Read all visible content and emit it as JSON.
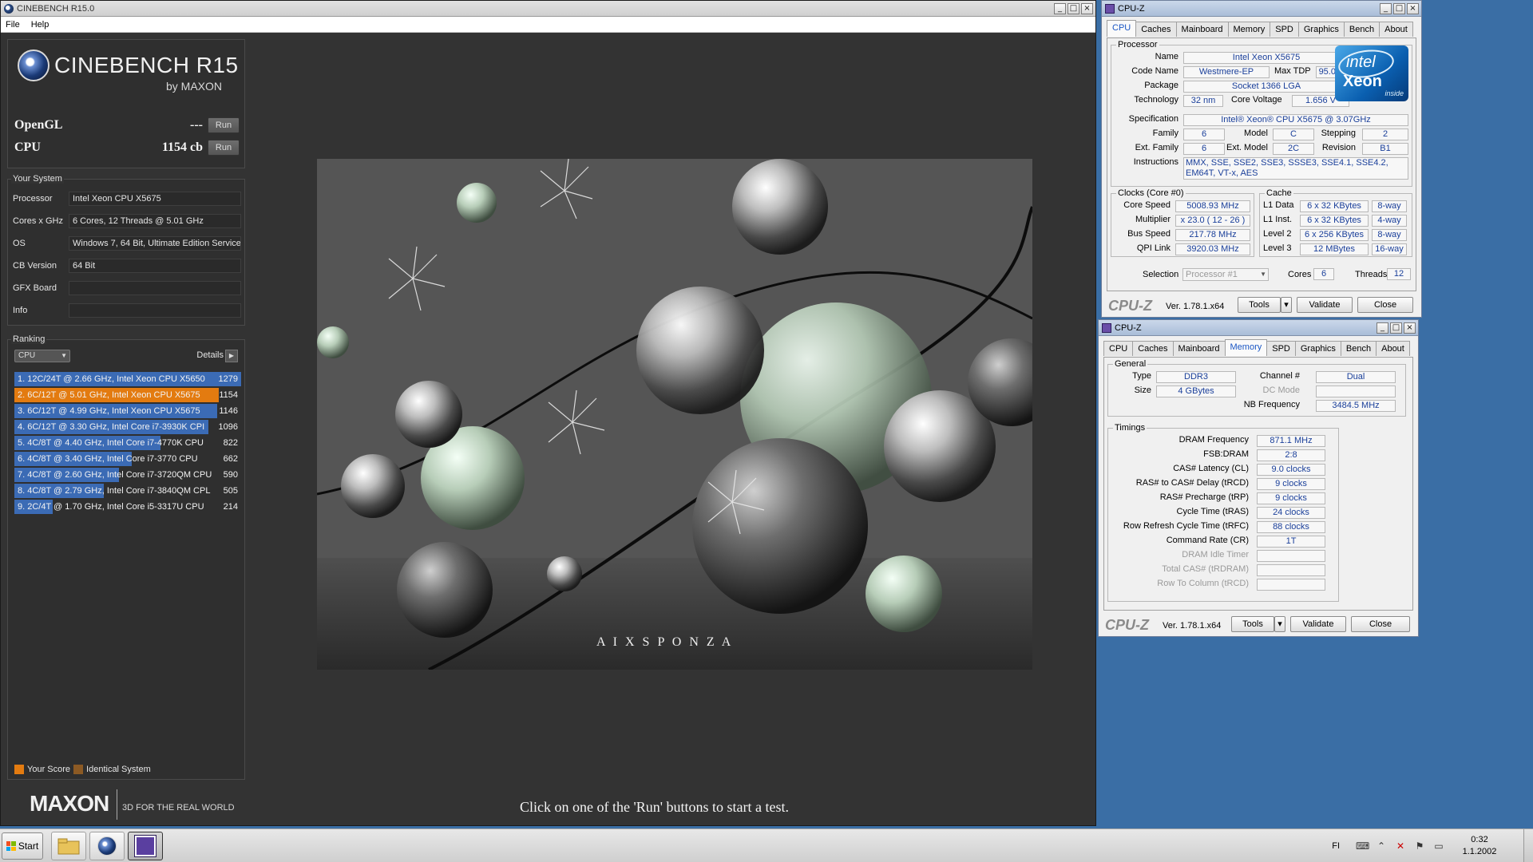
{
  "cinebench": {
    "window_title": "CINEBENCH R15.0",
    "menu": [
      "File",
      "Help"
    ],
    "logo_text": "CINEBENCH R15",
    "logo_by": "by MAXON",
    "tests": [
      {
        "name": "OpenGL",
        "score": "---",
        "run": "Run"
      },
      {
        "name": "CPU",
        "score": "1154 cb",
        "run": "Run"
      }
    ],
    "your_system": {
      "title": "Your System",
      "rows": [
        {
          "label": "Processor",
          "value": "Intel Xeon CPU X5675"
        },
        {
          "label": "Cores x GHz",
          "value": "6 Cores, 12 Threads @ 5.01 GHz"
        },
        {
          "label": "OS",
          "value": "Windows 7, 64 Bit, Ultimate Edition Service"
        },
        {
          "label": "CB Version",
          "value": "64 Bit"
        },
        {
          "label": "GFX Board",
          "value": ""
        },
        {
          "label": "Info",
          "value": ""
        }
      ]
    },
    "ranking": {
      "title": "Ranking",
      "select": "CPU",
      "details": "Details",
      "max_score": 1279,
      "items": [
        {
          "label": "1. 12C/24T @ 2.66 GHz, Intel Xeon CPU X5650",
          "score": 1279,
          "kind": "other"
        },
        {
          "label": "2. 6C/12T @ 5.01 GHz, Intel Xeon CPU X5675",
          "score": 1154,
          "kind": "yours"
        },
        {
          "label": "3. 6C/12T @ 4.99 GHz, Intel Xeon CPU X5675",
          "score": 1146,
          "kind": "other"
        },
        {
          "label": "4. 6C/12T @ 3.30 GHz,  Intel Core i7-3930K CPI",
          "score": 1096,
          "kind": "other"
        },
        {
          "label": "5. 4C/8T @ 4.40 GHz, Intel Core i7-4770K CPU",
          "score": 822,
          "kind": "other"
        },
        {
          "label": "6. 4C/8T @ 3.40 GHz,  Intel Core i7-3770 CPU",
          "score": 662,
          "kind": "other"
        },
        {
          "label": "7. 4C/8T @ 2.60 GHz, Intel Core i7-3720QM CPU",
          "score": 590,
          "kind": "other"
        },
        {
          "label": "8. 4C/8T @ 2.79 GHz, Intel Core i7-3840QM CPL",
          "score": 505,
          "kind": "other"
        },
        {
          "label": "9. 2C/4T @ 1.70 GHz,  Intel Core i5-3317U CPU",
          "score": 214,
          "kind": "other"
        }
      ],
      "legend_yours": "Your Score",
      "legend_identical": "Identical System"
    },
    "maxon_logo": "MAXON",
    "maxon_tagline": "3D FOR THE REAL WORLD",
    "render_watermark": "A I X S P O N Z A",
    "status": "Click on one of the 'Run' buttons to start a test.",
    "colors": {
      "yours": "#e37b10",
      "identical": "#8c5a24",
      "other": "#3b6bb5"
    }
  },
  "cpuz_cpu": {
    "title": "CPU-Z",
    "tabs": [
      "CPU",
      "Caches",
      "Mainboard",
      "Memory",
      "SPD",
      "Graphics",
      "Bench",
      "About"
    ],
    "active_tab": "CPU",
    "processor": {
      "title": "Processor",
      "name_label": "Name",
      "name": "Intel Xeon X5675",
      "code_name_label": "Code Name",
      "code_name": "Westmere-EP",
      "max_tdp_label": "Max TDP",
      "max_tdp": "95.0 W",
      "package_label": "Package",
      "package": "Socket 1366 LGA",
      "technology_label": "Technology",
      "technology": "32 nm",
      "core_voltage_label": "Core Voltage",
      "core_voltage": "1.656 V",
      "specification_label": "Specification",
      "specification": "Intel® Xeon® CPU           X5675  @ 3.07GHz",
      "family_label": "Family",
      "family": "6",
      "model_label": "Model",
      "model": "C",
      "stepping_label": "Stepping",
      "stepping": "2",
      "ext_family_label": "Ext. Family",
      "ext_family": "6",
      "ext_model_label": "Ext. Model",
      "ext_model": "2C",
      "revision_label": "Revision",
      "revision": "B1",
      "instructions_label": "Instructions",
      "instructions": "MMX, SSE, SSE2, SSE3, SSSE3, SSE4.1, SSE4.2, EM64T, VT-x, AES"
    },
    "intel_logo": {
      "brand": "intel",
      "product": "Xeon",
      "inside": "inside"
    },
    "clocks": {
      "title": "Clocks (Core #0)",
      "core_speed_label": "Core Speed",
      "core_speed": "5008.93 MHz",
      "multiplier_label": "Multiplier",
      "multiplier": "x 23.0 ( 12 - 26 )",
      "bus_speed_label": "Bus Speed",
      "bus_speed": "217.78 MHz",
      "qpi_label": "QPI Link",
      "qpi": "3920.03 MHz"
    },
    "cache": {
      "title": "Cache",
      "rows": [
        {
          "label": "L1 Data",
          "size": "6 x 32 KBytes",
          "way": "8-way"
        },
        {
          "label": "L1 Inst.",
          "size": "6 x 32 KBytes",
          "way": "4-way"
        },
        {
          "label": "Level 2",
          "size": "6 x 256 KBytes",
          "way": "8-way"
        },
        {
          "label": "Level 3",
          "size": "12 MBytes",
          "way": "16-way"
        }
      ]
    },
    "selection_label": "Selection",
    "selection": "Processor #1",
    "cores_label": "Cores",
    "cores": "6",
    "threads_label": "Threads",
    "threads": "12",
    "brand": "CPU-Z",
    "version": "Ver. 1.78.1.x64",
    "tools": "Tools",
    "validate": "Validate",
    "close": "Close"
  },
  "cpuz_mem": {
    "title": "CPU-Z",
    "tabs": [
      "CPU",
      "Caches",
      "Mainboard",
      "Memory",
      "SPD",
      "Graphics",
      "Bench",
      "About"
    ],
    "active_tab": "Memory",
    "general": {
      "title": "General",
      "type_label": "Type",
      "type": "DDR3",
      "size_label": "Size",
      "size": "4 GBytes",
      "channel_label": "Channel #",
      "channel": "Dual",
      "dc_mode_label": "DC Mode",
      "dc_mode": "",
      "nb_freq_label": "NB Frequency",
      "nb_freq": "3484.5 MHz"
    },
    "timings": {
      "title": "Timings",
      "rows": [
        {
          "label": "DRAM Frequency",
          "value": "871.1 MHz",
          "dim": false
        },
        {
          "label": "FSB:DRAM",
          "value": "2:8",
          "dim": false
        },
        {
          "label": "CAS# Latency (CL)",
          "value": "9.0 clocks",
          "dim": false
        },
        {
          "label": "RAS# to CAS# Delay (tRCD)",
          "value": "9 clocks",
          "dim": false
        },
        {
          "label": "RAS# Precharge (tRP)",
          "value": "9 clocks",
          "dim": false
        },
        {
          "label": "Cycle Time (tRAS)",
          "value": "24 clocks",
          "dim": false
        },
        {
          "label": "Row Refresh Cycle Time (tRFC)",
          "value": "88 clocks",
          "dim": false
        },
        {
          "label": "Command Rate (CR)",
          "value": "1T",
          "dim": false
        },
        {
          "label": "DRAM Idle Timer",
          "value": "",
          "dim": true
        },
        {
          "label": "Total CAS# (tRDRAM)",
          "value": "",
          "dim": true
        },
        {
          "label": "Row To Column (tRCD)",
          "value": "",
          "dim": true
        }
      ]
    },
    "brand": "CPU-Z",
    "version": "Ver. 1.78.1.x64",
    "tools": "Tools",
    "validate": "Validate",
    "close": "Close"
  },
  "taskbar": {
    "start": "Start",
    "lang": "FI",
    "time": "0:32",
    "date": "1.1.2002"
  }
}
